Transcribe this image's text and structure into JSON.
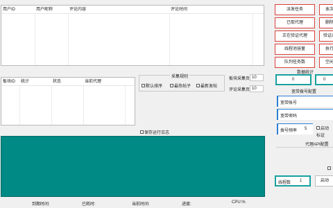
{
  "comments_table": {
    "columns": [
      "用户ID",
      "用户昵称",
      "评论内容",
      "评论时间"
    ]
  },
  "proxy_table": {
    "columns": [
      "板块ID",
      "统计",
      "状态",
      "当前代理"
    ]
  },
  "collect_rules": {
    "title": "采集规则",
    "checkboxes": [
      "默认排序",
      "最热帖子",
      "最新发帖"
    ]
  },
  "block_pages": {
    "label": "板块采集页",
    "value": "10"
  },
  "comment_pages": {
    "label": "评论采集页",
    "value": "10"
  },
  "save_log": {
    "label": "保存运行日志"
  },
  "buttons": {
    "post_task": "派发任务",
    "this_time": "本次",
    "got_proxy": "已取代理",
    "delete": "删除",
    "verifying_proxy": "正在验证代理",
    "verify_success": "验证成",
    "thread_pool": "线程池容量",
    "running": "执行",
    "queue_tasks": "队列任务数",
    "idle": "空闲",
    "start": "启动"
  },
  "data_stats": {
    "title": "数据统计",
    "value1": "0",
    "value2": "0"
  },
  "account_config": {
    "title": "宽带拨号配置",
    "account_label": "宽带账号",
    "password_label": "宽带密码",
    "dial_freq_label": "拨号频率",
    "dial_freq_value": "5",
    "auto_label": "启动",
    "mark_label": "标证"
  },
  "proxy_api": {
    "title": "代理API配置"
  },
  "threads": {
    "label": "线程数",
    "value": "1"
  },
  "status_bar": {
    "run_time": "到期时间:",
    "elapsed": "已耗时:",
    "current_time": "当前时间:",
    "progress": "进度:",
    "cpu": "CPU:%"
  }
}
